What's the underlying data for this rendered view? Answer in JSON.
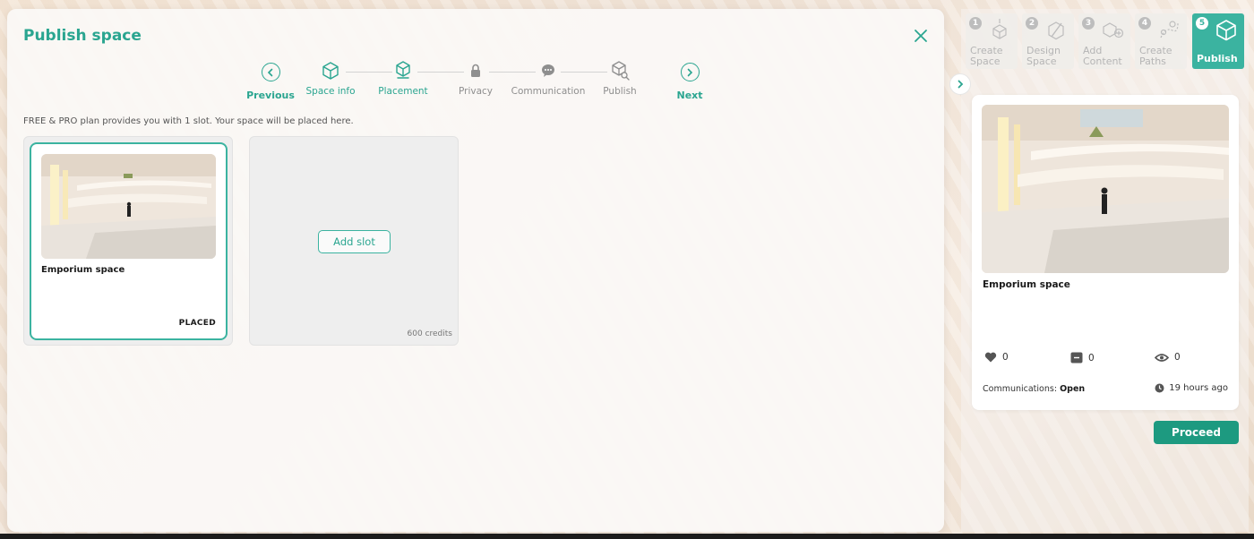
{
  "modal": {
    "title": "Publish space",
    "plan_info": "FREE & PRO plan provides you with 1 slot. Your space will be placed here."
  },
  "stepper": {
    "previous": "Previous",
    "next": "Next",
    "steps": [
      {
        "label": "Space info",
        "icon": "cube-icon",
        "state": "active"
      },
      {
        "label": "Placement",
        "icon": "placement-cube-icon",
        "state": "active"
      },
      {
        "label": "Privacy",
        "icon": "lock-icon",
        "state": "inactive"
      },
      {
        "label": "Communication",
        "icon": "chat-icon",
        "state": "inactive"
      },
      {
        "label": "Publish",
        "icon": "cube-search-icon",
        "state": "inactive"
      }
    ]
  },
  "slots": {
    "placed_card": {
      "title": "Emporium space",
      "status": "PLACED"
    },
    "empty_slot": {
      "button": "Add slot",
      "credits": "600 credits"
    }
  },
  "wizard": {
    "tabs": [
      {
        "num": "1",
        "label_line1": "Create",
        "label_line2": "Space"
      },
      {
        "num": "2",
        "label_line1": "Design",
        "label_line2": "Space"
      },
      {
        "num": "3",
        "label_line1": "Add",
        "label_line2": "Content"
      },
      {
        "num": "4",
        "label_line1": "Create",
        "label_line2": "Paths"
      },
      {
        "num": "5",
        "label_line1": "Publish",
        "label_line2": ""
      }
    ]
  },
  "preview": {
    "title": "Emporium space",
    "likes": "0",
    "comments": "0",
    "views": "0",
    "communications_label": "Communications:",
    "communications_value": "Open",
    "time": "19 hours ago"
  },
  "actions": {
    "proceed": "Proceed"
  },
  "colors": {
    "accent": "#2aa590",
    "accent_border": "#3bb3a0",
    "proceed_bg": "#1d9a80"
  }
}
